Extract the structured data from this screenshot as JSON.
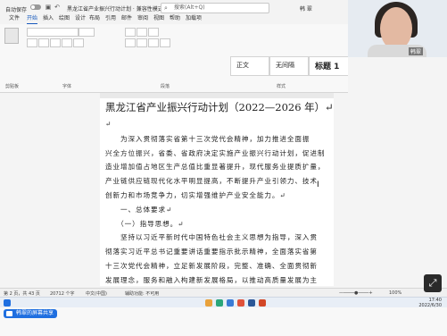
{
  "titlebar": {
    "autosave_label": "自动保存",
    "document_title": "黑龙江省产业振兴行动计划 · 兼容性模式",
    "search_placeholder": "搜索(Alt+Q)",
    "user_name": "韩 翠"
  },
  "menu": [
    "文件",
    "开始",
    "插入",
    "绘图",
    "设计",
    "布局",
    "引用",
    "邮件",
    "审阅",
    "视图",
    "帮助",
    "加载项"
  ],
  "menu_active_index": 1,
  "ribbon": {
    "group_labels": [
      "剪贴板",
      "字体",
      "段落",
      "样式"
    ],
    "styles": [
      "正文",
      "无间隔",
      "标题 1"
    ]
  },
  "document": {
    "title": "黑龙江省产业振兴行动计划（2022—2026 年）↵",
    "paragraphs": [
      "↵",
      "　　为深入贯彻落实省第十三次党代会精神，加力推进全面振",
      "兴全方位振兴，省委、省政府决定实施产业振兴行动计划，促进制",
      "造业增加值占地区生产总值比重显著提升，现代服务业提质扩量，",
      "产业链供应链现代化水平明显提高，不断提升产业引领力、技术",
      "创新力和市场竞争力，切实增强维护产业安全能力。↵",
      "　　一、总体要求↵",
      "　　（一）指导思想。↵",
      "　　坚持以习近平新时代中国特色社会主义思想为指导，深入贯",
      "彻落实习近平总书记重要讲话重要指示批示精神，全面落实省第",
      "十三次党代会精神，立足新发展阶段，完整、准确、全面贯彻新",
      "发展理念，服务和融入构建新发展格局，以推动高质量发展为主"
    ]
  },
  "status": {
    "page": "第 2 页，共 43 页",
    "words": "20712 个字",
    "language": "中文(中国)",
    "accessibility": "辅助功能: 不可用",
    "zoom": "100%"
  },
  "taskbar": {
    "time": "17:40",
    "date": "2022/6/30"
  },
  "webcam": {
    "name_tag": "韩翠"
  },
  "share": {
    "label": "韩翠的屏幕共享"
  }
}
